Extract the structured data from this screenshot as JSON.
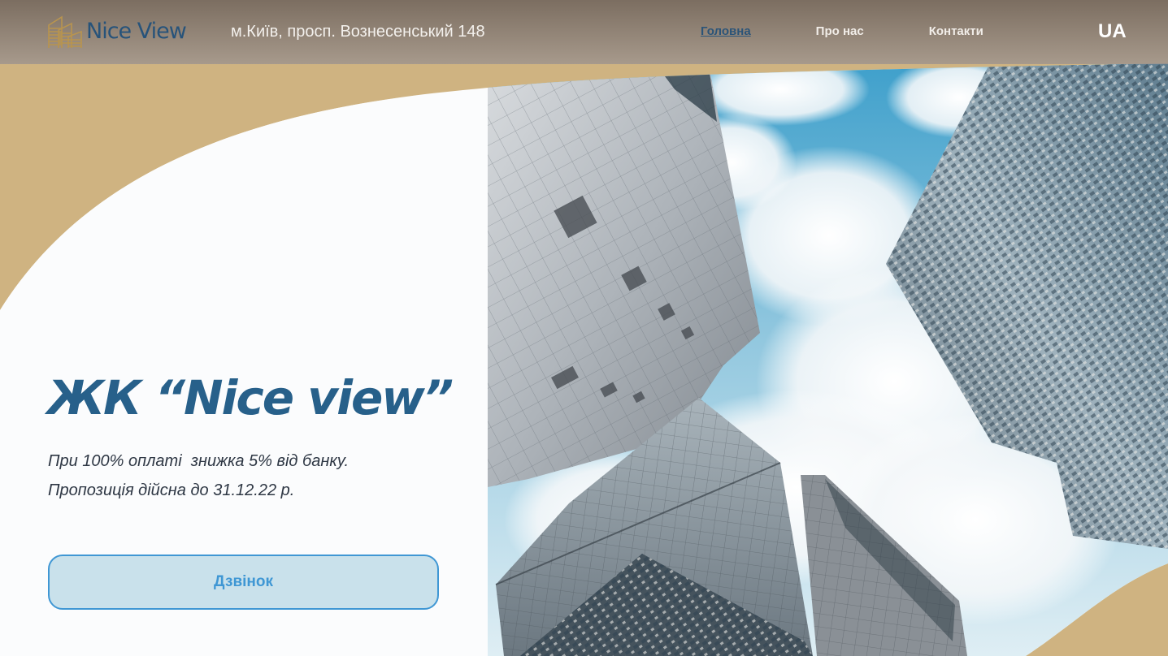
{
  "header": {
    "logo_text": "Nice View",
    "address": "м.Київ, просп. Вознесенський 148",
    "nav": [
      {
        "label": "Головна",
        "active": true
      },
      {
        "label": "Про нас",
        "active": false
      },
      {
        "label": "Контакти",
        "active": false
      }
    ],
    "language": "UA"
  },
  "hero": {
    "title": "ЖК “Nice view”",
    "line1": "При 100% оплаті  знижка 5% від банку.",
    "line2": "Пропозиція дійсна до 31.12.22 р.",
    "button_label": "Дзвінок",
    "image_icon": "skyscrapers-photo"
  },
  "colors": {
    "accent_gold": "#cfb381",
    "brand_blue": "#27608a",
    "button_blue": "#3f97d4",
    "button_bg": "#c9e1eb"
  }
}
